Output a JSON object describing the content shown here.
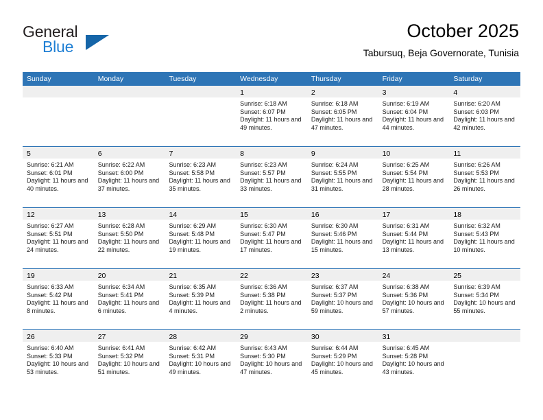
{
  "brand": {
    "word_one": "General",
    "word_two": "Blue",
    "logo_icon": "triangle-logo-icon"
  },
  "header": {
    "title": "October 2025",
    "subtitle": "Tabursuq, Beja Governorate, Tunisia"
  },
  "colors": {
    "header_blue": "#2e75b6",
    "brand_blue": "#1f7fd4",
    "logo_blue": "#1565a8",
    "daynum_band": "#efefef",
    "text": "#000000"
  },
  "weekday_headers": [
    "Sunday",
    "Monday",
    "Tuesday",
    "Wednesday",
    "Thursday",
    "Friday",
    "Saturday"
  ],
  "labels": {
    "sunrise_prefix": "Sunrise:",
    "sunset_prefix": "Sunset:",
    "daylight_prefix": "Daylight:"
  },
  "weeks": [
    [
      {
        "day": "",
        "empty": true
      },
      {
        "day": "",
        "empty": true
      },
      {
        "day": "",
        "empty": true
      },
      {
        "day": "1",
        "sunrise": "Sunrise: 6:18 AM",
        "sunset": "Sunset: 6:07 PM",
        "daylight": "Daylight: 11 hours and 49 minutes."
      },
      {
        "day": "2",
        "sunrise": "Sunrise: 6:18 AM",
        "sunset": "Sunset: 6:05 PM",
        "daylight": "Daylight: 11 hours and 47 minutes."
      },
      {
        "day": "3",
        "sunrise": "Sunrise: 6:19 AM",
        "sunset": "Sunset: 6:04 PM",
        "daylight": "Daylight: 11 hours and 44 minutes."
      },
      {
        "day": "4",
        "sunrise": "Sunrise: 6:20 AM",
        "sunset": "Sunset: 6:03 PM",
        "daylight": "Daylight: 11 hours and 42 minutes."
      }
    ],
    [
      {
        "day": "5",
        "sunrise": "Sunrise: 6:21 AM",
        "sunset": "Sunset: 6:01 PM",
        "daylight": "Daylight: 11 hours and 40 minutes."
      },
      {
        "day": "6",
        "sunrise": "Sunrise: 6:22 AM",
        "sunset": "Sunset: 6:00 PM",
        "daylight": "Daylight: 11 hours and 37 minutes."
      },
      {
        "day": "7",
        "sunrise": "Sunrise: 6:23 AM",
        "sunset": "Sunset: 5:58 PM",
        "daylight": "Daylight: 11 hours and 35 minutes."
      },
      {
        "day": "8",
        "sunrise": "Sunrise: 6:23 AM",
        "sunset": "Sunset: 5:57 PM",
        "daylight": "Daylight: 11 hours and 33 minutes."
      },
      {
        "day": "9",
        "sunrise": "Sunrise: 6:24 AM",
        "sunset": "Sunset: 5:55 PM",
        "daylight": "Daylight: 11 hours and 31 minutes."
      },
      {
        "day": "10",
        "sunrise": "Sunrise: 6:25 AM",
        "sunset": "Sunset: 5:54 PM",
        "daylight": "Daylight: 11 hours and 28 minutes."
      },
      {
        "day": "11",
        "sunrise": "Sunrise: 6:26 AM",
        "sunset": "Sunset: 5:53 PM",
        "daylight": "Daylight: 11 hours and 26 minutes."
      }
    ],
    [
      {
        "day": "12",
        "sunrise": "Sunrise: 6:27 AM",
        "sunset": "Sunset: 5:51 PM",
        "daylight": "Daylight: 11 hours and 24 minutes."
      },
      {
        "day": "13",
        "sunrise": "Sunrise: 6:28 AM",
        "sunset": "Sunset: 5:50 PM",
        "daylight": "Daylight: 11 hours and 22 minutes."
      },
      {
        "day": "14",
        "sunrise": "Sunrise: 6:29 AM",
        "sunset": "Sunset: 5:48 PM",
        "daylight": "Daylight: 11 hours and 19 minutes."
      },
      {
        "day": "15",
        "sunrise": "Sunrise: 6:30 AM",
        "sunset": "Sunset: 5:47 PM",
        "daylight": "Daylight: 11 hours and 17 minutes."
      },
      {
        "day": "16",
        "sunrise": "Sunrise: 6:30 AM",
        "sunset": "Sunset: 5:46 PM",
        "daylight": "Daylight: 11 hours and 15 minutes."
      },
      {
        "day": "17",
        "sunrise": "Sunrise: 6:31 AM",
        "sunset": "Sunset: 5:44 PM",
        "daylight": "Daylight: 11 hours and 13 minutes."
      },
      {
        "day": "18",
        "sunrise": "Sunrise: 6:32 AM",
        "sunset": "Sunset: 5:43 PM",
        "daylight": "Daylight: 11 hours and 10 minutes."
      }
    ],
    [
      {
        "day": "19",
        "sunrise": "Sunrise: 6:33 AM",
        "sunset": "Sunset: 5:42 PM",
        "daylight": "Daylight: 11 hours and 8 minutes."
      },
      {
        "day": "20",
        "sunrise": "Sunrise: 6:34 AM",
        "sunset": "Sunset: 5:41 PM",
        "daylight": "Daylight: 11 hours and 6 minutes."
      },
      {
        "day": "21",
        "sunrise": "Sunrise: 6:35 AM",
        "sunset": "Sunset: 5:39 PM",
        "daylight": "Daylight: 11 hours and 4 minutes."
      },
      {
        "day": "22",
        "sunrise": "Sunrise: 6:36 AM",
        "sunset": "Sunset: 5:38 PM",
        "daylight": "Daylight: 11 hours and 2 minutes."
      },
      {
        "day": "23",
        "sunrise": "Sunrise: 6:37 AM",
        "sunset": "Sunset: 5:37 PM",
        "daylight": "Daylight: 10 hours and 59 minutes."
      },
      {
        "day": "24",
        "sunrise": "Sunrise: 6:38 AM",
        "sunset": "Sunset: 5:36 PM",
        "daylight": "Daylight: 10 hours and 57 minutes."
      },
      {
        "day": "25",
        "sunrise": "Sunrise: 6:39 AM",
        "sunset": "Sunset: 5:34 PM",
        "daylight": "Daylight: 10 hours and 55 minutes."
      }
    ],
    [
      {
        "day": "26",
        "sunrise": "Sunrise: 6:40 AM",
        "sunset": "Sunset: 5:33 PM",
        "daylight": "Daylight: 10 hours and 53 minutes."
      },
      {
        "day": "27",
        "sunrise": "Sunrise: 6:41 AM",
        "sunset": "Sunset: 5:32 PM",
        "daylight": "Daylight: 10 hours and 51 minutes."
      },
      {
        "day": "28",
        "sunrise": "Sunrise: 6:42 AM",
        "sunset": "Sunset: 5:31 PM",
        "daylight": "Daylight: 10 hours and 49 minutes."
      },
      {
        "day": "29",
        "sunrise": "Sunrise: 6:43 AM",
        "sunset": "Sunset: 5:30 PM",
        "daylight": "Daylight: 10 hours and 47 minutes."
      },
      {
        "day": "30",
        "sunrise": "Sunrise: 6:44 AM",
        "sunset": "Sunset: 5:29 PM",
        "daylight": "Daylight: 10 hours and 45 minutes."
      },
      {
        "day": "31",
        "sunrise": "Sunrise: 6:45 AM",
        "sunset": "Sunset: 5:28 PM",
        "daylight": "Daylight: 10 hours and 43 minutes."
      },
      {
        "day": "",
        "empty": true
      }
    ]
  ]
}
